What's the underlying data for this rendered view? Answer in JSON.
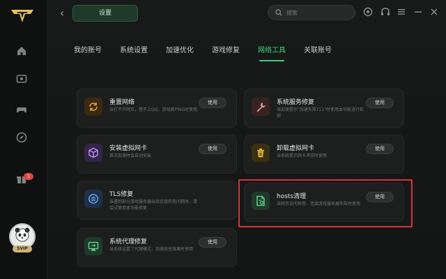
{
  "colors": {
    "accent": "#3fcf7c",
    "highlight_border": "#d8333a",
    "badge": "#e2423c"
  },
  "sidebar": {
    "items": [
      {
        "icon": "home-icon"
      },
      {
        "icon": "game-library-icon"
      },
      {
        "icon": "gamepad-icon"
      },
      {
        "icon": "compass-icon"
      },
      {
        "icon": "gift-icon",
        "badge": "1"
      }
    ],
    "vip_label": "SVIP"
  },
  "header": {
    "back_icon": "back-arrow-icon",
    "title": "设置",
    "search_placeholder": "搜索",
    "icons": [
      "customer-service-icon",
      "headset-icon",
      "menu-icon",
      "minimize-icon",
      "close-icon"
    ]
  },
  "tabs": [
    {
      "label": "我的账号",
      "active": false
    },
    {
      "label": "系统设置",
      "active": false
    },
    {
      "label": "加速优化",
      "active": false
    },
    {
      "label": "游戏修复",
      "active": false
    },
    {
      "label": "网络工具",
      "active": true
    },
    {
      "label": "关联账号",
      "active": false
    }
  ],
  "tools": [
    {
      "title": "重置网络",
      "desc": "当打不开网页，登不上QQ，游戏跳PING时使用",
      "button": "使用",
      "icon": "reset-network-icon",
      "color": "#c9892a"
    },
    {
      "title": "系统服务修复",
      "desc": "当加速提示\"加速失败711\"时使用本功能进行检测",
      "button": "使用",
      "icon": "wrench-icon",
      "color": "#8a4b4b"
    },
    {
      "title": "安装虚拟网卡",
      "desc": "首次加速时会自动安装",
      "button": "使用",
      "icon": "cube-icon",
      "color": "#7b52c7"
    },
    {
      "title": "卸载虚拟网卡",
      "desc": "当系统提示网卡冲突时使用",
      "button": "使用",
      "icon": "trash-icon",
      "color": "#c49a22"
    },
    {
      "title": "TLS修复",
      "desc": "当遇到部分游戏服务器出现连接失败问题时，请尝试使用本功能修复",
      "button": "使用",
      "icon": "tls-icon",
      "color": "#2f6fc2"
    },
    {
      "title": "hosts清理",
      "desc": "当网页访问异常、连接游戏服务器失败时使用",
      "button": "使用",
      "icon": "hosts-file-icon",
      "color": "#2f8a4e"
    },
    {
      "title": "系统代理修复",
      "desc": "当系统设置了代理模式，加速后无效果时使用",
      "button": "使用",
      "icon": "proxy-monitor-icon",
      "color": "#2f9a5e"
    }
  ]
}
